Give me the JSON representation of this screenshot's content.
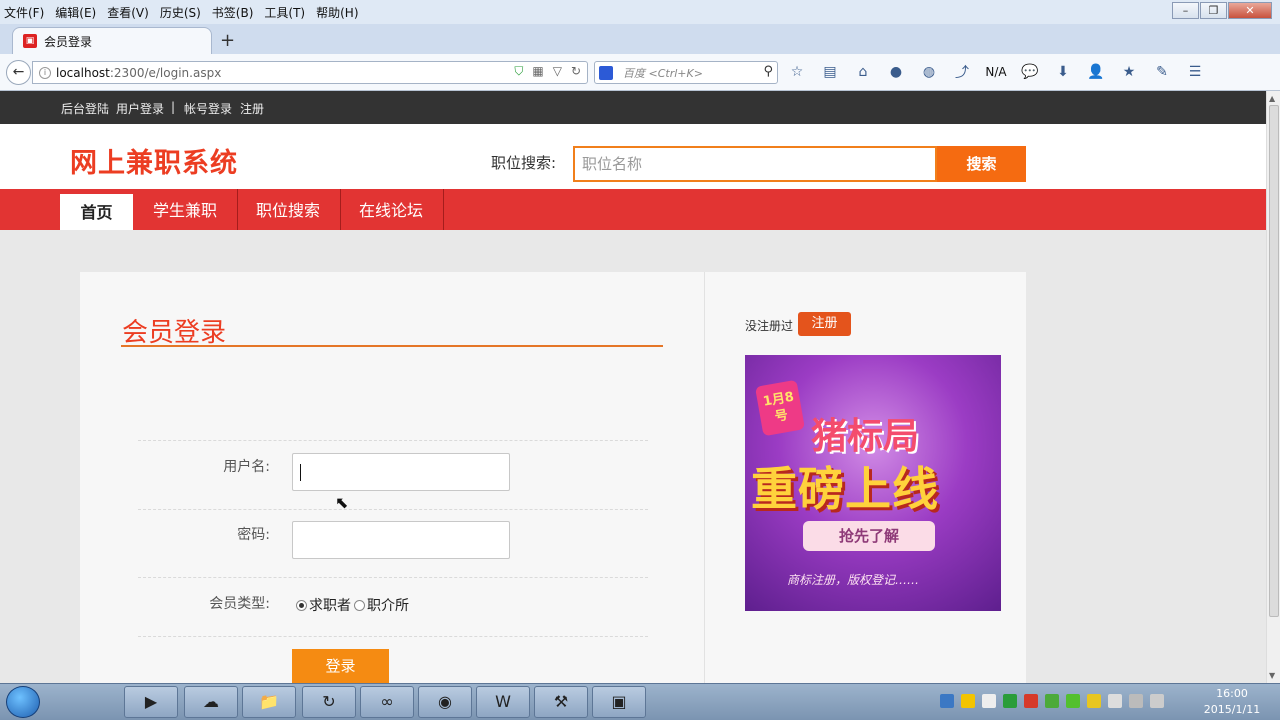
{
  "menubar": {
    "items": [
      "文件(F)",
      "编辑(E)",
      "查看(V)",
      "历史(S)",
      "书签(B)",
      "工具(T)",
      "帮助(H)"
    ]
  },
  "tab": {
    "title": "会员登录"
  },
  "address": {
    "host": "localhost",
    "path": ":2300/e/login.aspx"
  },
  "browser_search": {
    "placeholder": "百度 <Ctrl+K>"
  },
  "toolbar": {
    "na_label": "N/A"
  },
  "topstrip": {
    "admin_login": "后台登陆",
    "user_login": "用户登录",
    "sep": "|",
    "account_login": "帐号登录",
    "register": "注册"
  },
  "header": {
    "logo": "网上兼职系统",
    "search_label": "职位搜索:",
    "search_placeholder": "职位名称",
    "search_button": "搜索"
  },
  "nav": {
    "home": "首页",
    "items": [
      "学生兼职",
      "职位搜索",
      "在线论坛"
    ]
  },
  "login": {
    "title": "会员登录",
    "username_label": "用户名:",
    "password_label": "密码:",
    "member_type_label": "会员类型:",
    "options": [
      "求职者",
      "职介所"
    ],
    "selected": "求职者",
    "submit": "登录"
  },
  "sidebar": {
    "not_registered": "没注册过",
    "register_button": "注册"
  },
  "banner": {
    "date": "1月8号",
    "line1": "猪标局",
    "line2": "重磅上线",
    "button": "抢先了解",
    "footer": "商标注册，版权登记……"
  },
  "taskbar": {
    "time": "16:00",
    "date": "2015/1/11"
  },
  "colors": {
    "brand_red": "#e23433",
    "orange": "#f56b11",
    "logo_red": "#ec3d22"
  }
}
